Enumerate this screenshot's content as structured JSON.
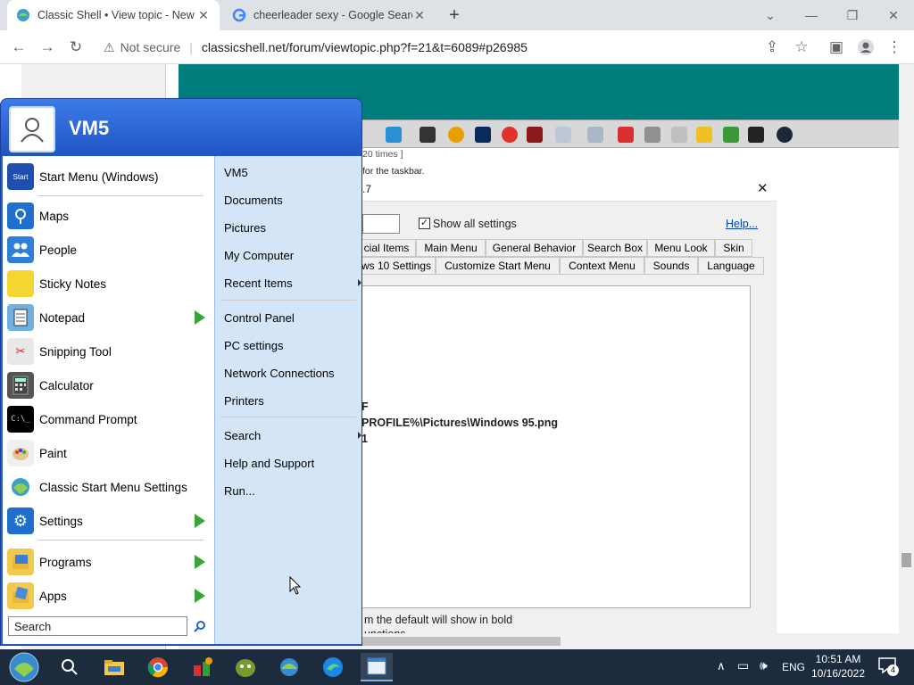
{
  "browser": {
    "tabs": [
      {
        "title": "Classic Shell • View topic - New t"
      },
      {
        "title": "cheerleader sexy - Google Search"
      }
    ],
    "new_tab": "+",
    "security": "Not secure",
    "url": "classicshell.net/forum/viewtopic.php?f=21&t=6089#p26985",
    "window_controls": {
      "minimize": "—",
      "restore": "❐",
      "close": "✕",
      "tab_list": "⌄"
    }
  },
  "page": {
    "caption": "20 times ]",
    "taskbar_note": "for the taskbar.",
    "dialog": {
      "title_fragment": ".7",
      "show_all_settings_label": "Show all settings",
      "show_all_checked": true,
      "help_link": "Help...",
      "tabs_row1": [
        "cial Items",
        "Main Menu",
        "General Behavior",
        "Search Box",
        "Menu Look",
        "Skin"
      ],
      "tabs_row2": [
        "ws 10 Settings",
        "Customize Start Menu",
        "Context Menu",
        "Sounds",
        "Language"
      ],
      "content_lines": [
        "F",
        "PROFILE%\\Pictures\\Windows 95.png",
        "1"
      ],
      "footer_line1": "m the default will show in bold",
      "footer_line2": "unctions"
    }
  },
  "start_menu": {
    "user_name": "VM5",
    "pinned": [
      {
        "label": "Start Menu (Windows)",
        "icon": "start-menu-icon"
      }
    ],
    "programs": [
      {
        "label": "Maps",
        "icon": "maps-icon",
        "arrow": false
      },
      {
        "label": "People",
        "icon": "people-icon",
        "arrow": false
      },
      {
        "label": "Sticky Notes",
        "icon": "sticky-notes-icon",
        "arrow": false
      },
      {
        "label": "Notepad",
        "icon": "notepad-icon",
        "arrow": true
      },
      {
        "label": "Snipping Tool",
        "icon": "snipping-tool-icon",
        "arrow": false
      },
      {
        "label": "Calculator",
        "icon": "calculator-icon",
        "arrow": false
      },
      {
        "label": "Command Prompt",
        "icon": "command-prompt-icon",
        "arrow": false
      },
      {
        "label": "Paint",
        "icon": "paint-icon",
        "arrow": false
      },
      {
        "label": "Classic Start Menu Settings",
        "icon": "classic-shell-icon",
        "arrow": false
      },
      {
        "label": "Settings",
        "icon": "settings-gear-icon",
        "arrow": true
      }
    ],
    "bottom": [
      {
        "label": "Programs",
        "icon": "programs-icon",
        "arrow": true
      },
      {
        "label": "Apps",
        "icon": "apps-icon",
        "arrow": true
      }
    ],
    "search_placeholder": "Search",
    "right_items": [
      {
        "label": "VM5",
        "arrow": false
      },
      {
        "label": "Documents",
        "arrow": false
      },
      {
        "label": "Pictures",
        "arrow": false
      },
      {
        "label": "My Computer",
        "arrow": false
      },
      {
        "label": "Recent Items",
        "arrow": true
      },
      {
        "label": "Control Panel",
        "arrow": false
      },
      {
        "label": "PC settings",
        "arrow": false
      },
      {
        "label": "Network Connections",
        "arrow": false
      },
      {
        "label": "Printers",
        "arrow": false
      },
      {
        "label": "Search",
        "arrow": true
      },
      {
        "label": "Help and Support",
        "arrow": false
      },
      {
        "label": "Run...",
        "arrow": false
      }
    ]
  },
  "taskbar": {
    "time": "10:51 AM",
    "date": "10/16/2022",
    "language": "ENG",
    "notification_count": "4"
  },
  "colors": {
    "accent": "#2a5dc8",
    "teal": "#007c7c",
    "taskbar": "#1c2b3e",
    "arrow_green": "#3aa63a"
  }
}
